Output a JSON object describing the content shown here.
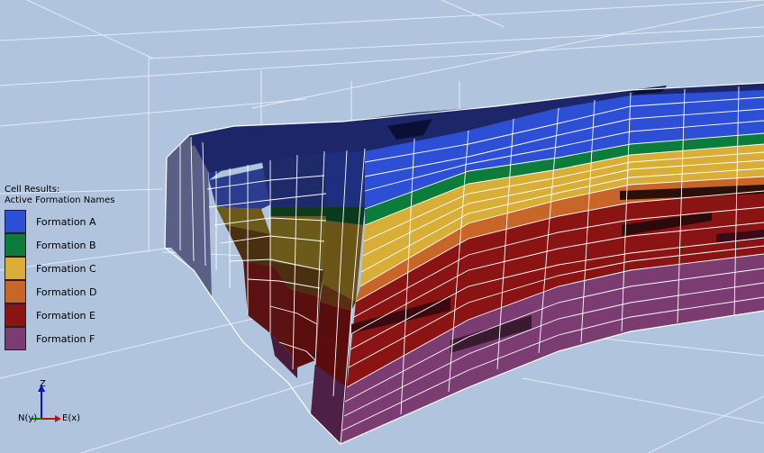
{
  "legend": {
    "title_line1": "Cell Results:",
    "title_line2": "Active Formation Names",
    "items": [
      {
        "label": "Formation A",
        "color": "#2d4fd6"
      },
      {
        "label": "Formation B",
        "color": "#0c7c3a"
      },
      {
        "label": "Formation C",
        "color": "#d9ae37"
      },
      {
        "label": "Formation D",
        "color": "#c8662a"
      },
      {
        "label": "Formation E",
        "color": "#8a1414"
      },
      {
        "label": "Formation F",
        "color": "#7b3c72"
      }
    ]
  },
  "axes": {
    "z_label": "Z",
    "n_label": "N(y)",
    "e_label": "E(x)"
  },
  "colors": {
    "background": "#b0c4de",
    "grid": "#dfe6f0"
  }
}
